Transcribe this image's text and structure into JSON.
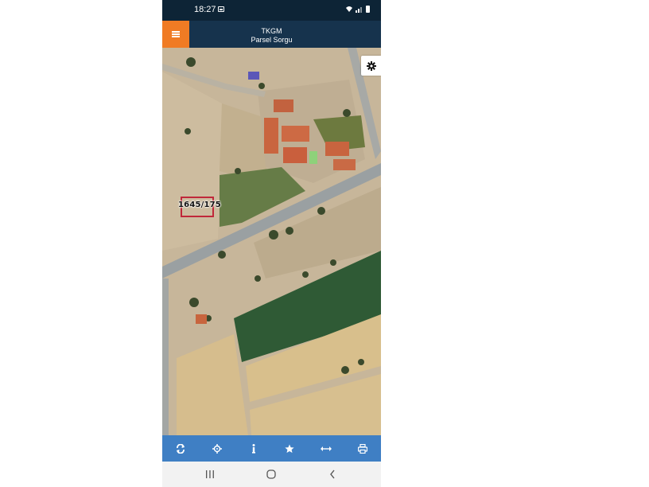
{
  "status_bar": {
    "time": "18:27",
    "icons": [
      "gallery-icon",
      "wifi-icon",
      "signal-icon",
      "battery-icon"
    ]
  },
  "header": {
    "title": "TKGM",
    "subtitle": "Parsel Sorgu",
    "menu_icon": "hamburger-menu-icon",
    "menu_color": "#f07b24",
    "background_color": "#16334d"
  },
  "map": {
    "type": "satellite",
    "parcel_label": "1645/175",
    "parcel_outline_color": "#c0283a",
    "settings_icon": "gear-icon"
  },
  "toolbar": {
    "background_color": "#3f7fc4",
    "tools": [
      {
        "name": "refresh",
        "icon": "refresh-icon"
      },
      {
        "name": "locate",
        "icon": "crosshair-icon"
      },
      {
        "name": "info",
        "icon": "info-icon"
      },
      {
        "name": "favorites",
        "icon": "star-icon"
      },
      {
        "name": "measure",
        "icon": "measure-icon"
      },
      {
        "name": "print",
        "icon": "print-icon"
      }
    ]
  },
  "navigation_bar": {
    "buttons": [
      "recent-apps-icon",
      "home-icon",
      "back-icon"
    ]
  }
}
